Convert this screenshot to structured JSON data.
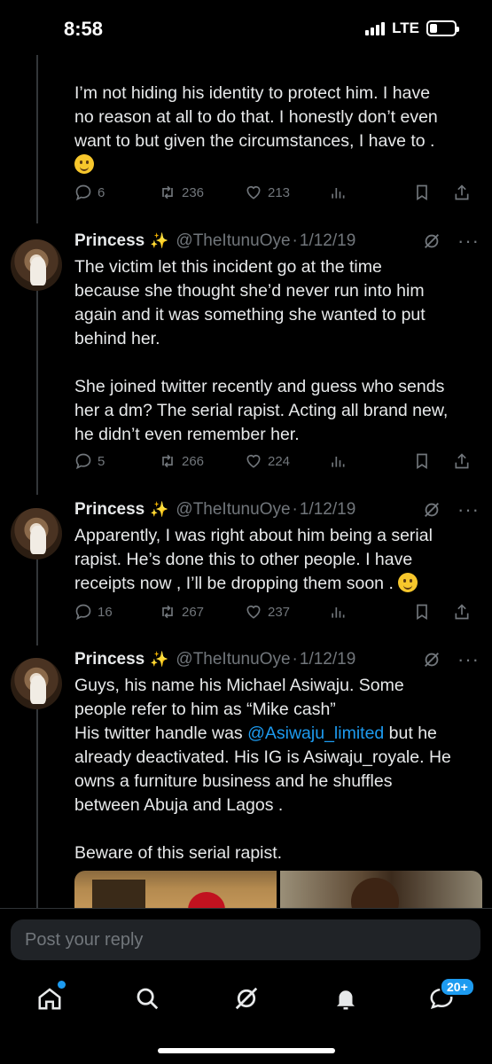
{
  "status_bar": {
    "time": "8:58",
    "network": "LTE",
    "battery_level": 0.3
  },
  "tweets": [
    {
      "text_lines": [
        "I’m not hiding his identity to protect him. I have",
        "no reason at all to do that. I honestly don’t even",
        "want to but given the circumstances, I have to ."
      ],
      "emoji": "slightly-smiling-face",
      "replies": "6",
      "retweets": "236",
      "likes": "213"
    },
    {
      "name": "Princess",
      "handle": "@TheItunuOye",
      "separator": "·",
      "date": "1/12/19",
      "paragraph1": [
        "The victim let this incident go at the time",
        "because she thought she’d never run into him",
        "again and it was something she wanted to put",
        "behind her."
      ],
      "paragraph2": [
        "She joined twitter recently and guess who sends",
        "her a dm? The serial rapist. Acting all brand new,",
        "he didn’t even remember her."
      ],
      "replies": "5",
      "retweets": "266",
      "likes": "224"
    },
    {
      "name": "Princess",
      "handle": "@TheItunuOye",
      "separator": "·",
      "date": "1/12/19",
      "lines": [
        "Apparently, I was right about him being a serial",
        "rapist. He’s done this to other people. I have",
        "receipts now , I’ll be dropping them soon ."
      ],
      "emoji": "slightly-smiling-face",
      "replies": "16",
      "retweets": "267",
      "likes": "237"
    },
    {
      "name": "Princess",
      "handle": "@TheItunuOye",
      "separator": "·",
      "date": "1/12/19",
      "line1": "Guys, his name his Michael Asiwaju. Some",
      "line2": "people refer to him as “Mike cash”",
      "line3_before": "His twitter handle was ",
      "line3_link": "@Asiwaju_limited",
      "line3_after": " but he",
      "line4": "already deactivated. His IG is Asiwaju_royale. He",
      "line5": "owns a furniture business and he shuffles",
      "line6": "between Abuja and Lagos .",
      "line7": "Beware of this serial rapist."
    }
  ],
  "reply_bar": {
    "placeholder": "Post your reply"
  },
  "bottom_nav": {
    "items": [
      "home-icon",
      "search-icon",
      "grok-icon",
      "notifications-icon",
      "messages-icon"
    ],
    "messages_badge": "20+"
  },
  "colors": {
    "background": "#000000",
    "text": "#e7e9ea",
    "muted": "#71767b",
    "accent": "#1d9bf0"
  }
}
